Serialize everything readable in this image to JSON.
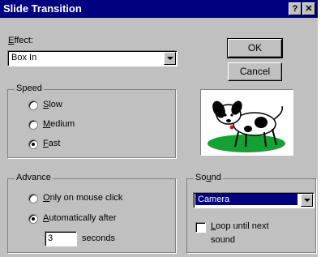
{
  "window": {
    "title": "Slide Transition",
    "help_glyph": "?",
    "close_glyph": "✕"
  },
  "effect": {
    "label_mnemonic": "E",
    "label_rest": "ffect:",
    "selected": "Box In"
  },
  "buttons": {
    "ok": "OK",
    "cancel": "Cancel"
  },
  "speed": {
    "title": "Speed",
    "options": [
      {
        "mnemonic": "S",
        "rest": "low",
        "checked": false
      },
      {
        "mnemonic": "M",
        "rest": "edium",
        "checked": false
      },
      {
        "mnemonic": "F",
        "rest": "ast",
        "checked": true
      }
    ]
  },
  "preview": {
    "icon": "dog-picture"
  },
  "advance": {
    "title": "Advance",
    "option_mouse": {
      "mnemonic": "O",
      "rest": "nly on mouse click",
      "checked": false
    },
    "option_auto": {
      "mnemonic": "A",
      "rest": "utomatically after",
      "checked": true
    },
    "seconds_value": "3",
    "seconds_label": "seconds"
  },
  "sound": {
    "title_pre": "So",
    "title_mnemonic": "u",
    "title_post": "nd",
    "selected": "Camera",
    "loop_mnemonic": "L",
    "loop_rest": "oop until next",
    "loop_line2": "sound",
    "loop_checked": false
  },
  "colors": {
    "titlebar": "#000080",
    "face": "#c0c0c0",
    "highlight": "#000080"
  }
}
